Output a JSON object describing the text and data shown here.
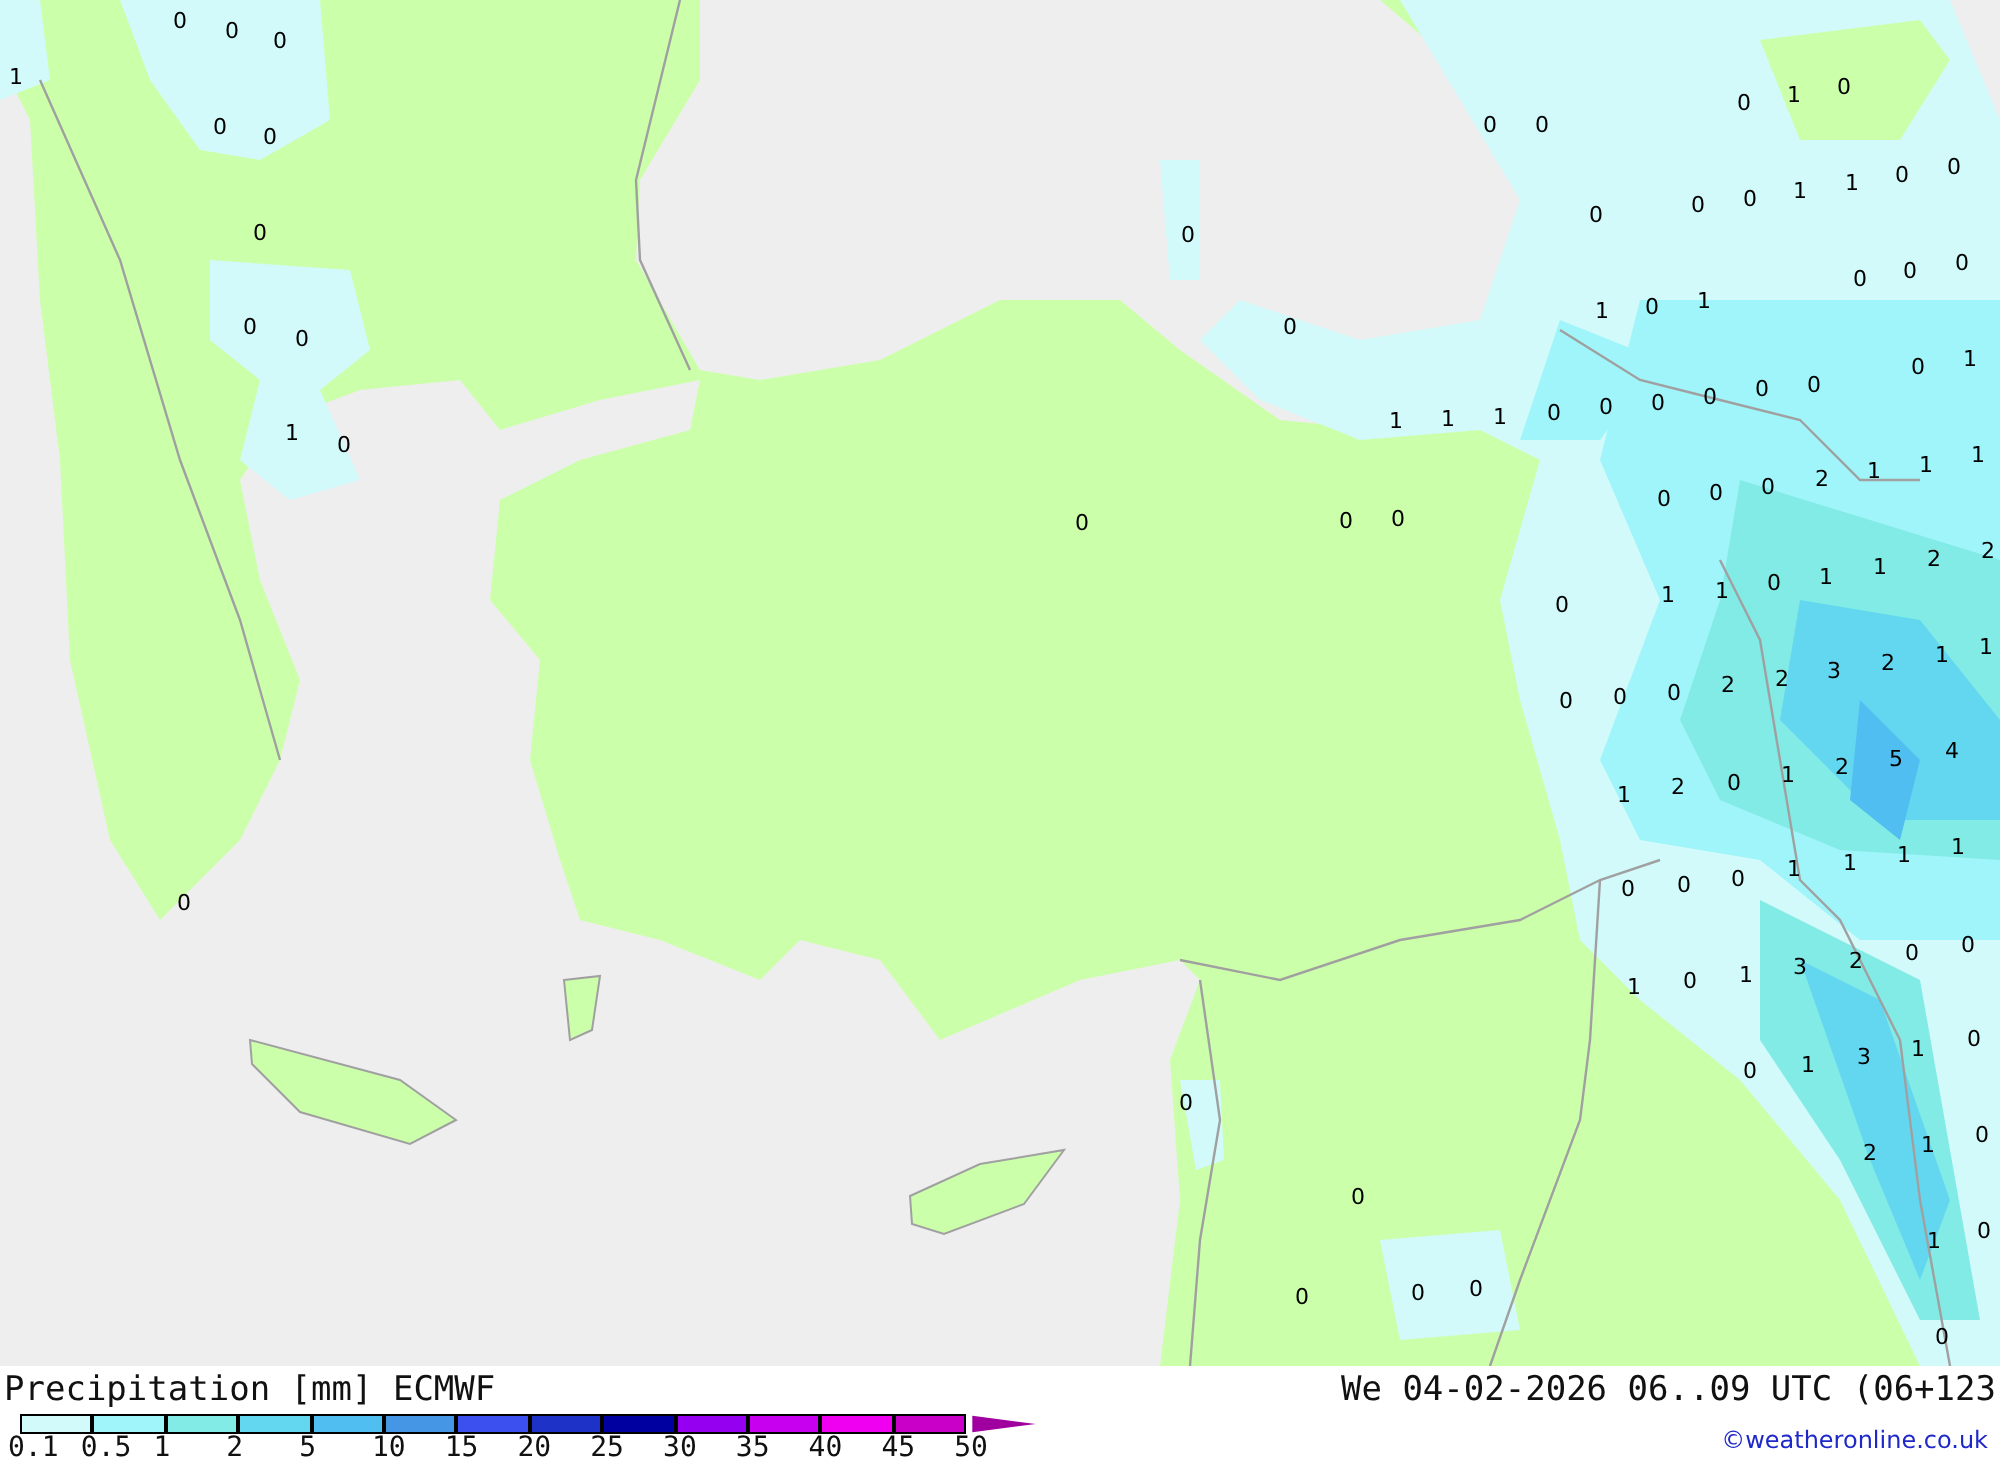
{
  "map": {
    "values": [
      "0",
      "0",
      "0",
      "1",
      "0",
      "0",
      "0",
      "0",
      "0",
      "1",
      "0",
      "0",
      "0",
      "0",
      "0",
      "0",
      "0",
      "0",
      "0",
      "0",
      "0",
      "0",
      "0",
      "0",
      "0",
      "1",
      "0",
      "0",
      "0",
      "0",
      "1",
      "1",
      "0",
      "0",
      "0",
      "0",
      "0",
      "1",
      "0",
      "1",
      "0",
      "1",
      "1",
      "1",
      "1",
      "0",
      "0",
      "0",
      "0",
      "0",
      "0",
      "2",
      "1",
      "1",
      "1",
      "0",
      "0",
      "0",
      "0",
      "1",
      "1",
      "0",
      "1",
      "1",
      "2",
      "2",
      "0",
      "0",
      "0",
      "2",
      "2",
      "3",
      "2",
      "1",
      "1",
      "1",
      "2",
      "0",
      "1",
      "2",
      "5",
      "4",
      "0",
      "0",
      "0",
      "1",
      "1",
      "1",
      "1",
      "1",
      "0",
      "1",
      "3",
      "2",
      "0",
      "0",
      "0",
      "1",
      "3",
      "1",
      "0",
      "2",
      "1",
      "0",
      "1",
      "0",
      "0"
    ]
  },
  "legend": {
    "title": "Precipitation [mm] ECMWF",
    "valid_time": "We 04-02-2026 06..09 UTC (06+123",
    "items": [
      {
        "kind": "swatch",
        "label": "0.1",
        "color": "#d2fafa"
      },
      {
        "kind": "swatch",
        "label": "0.5",
        "color": "#a0f5fa"
      },
      {
        "kind": "swatch",
        "label": "1",
        "color": "#82ebe6"
      },
      {
        "kind": "swatch",
        "label": "2",
        "color": "#64d7f0"
      },
      {
        "kind": "swatch",
        "label": "5",
        "color": "#50bef0"
      },
      {
        "kind": "swatch",
        "label": "10",
        "color": "#4696e6"
      },
      {
        "kind": "swatch",
        "label": "15",
        "color": "#3c50f0"
      },
      {
        "kind": "swatch",
        "label": "20",
        "color": "#1e32c8"
      },
      {
        "kind": "swatch",
        "label": "25",
        "color": "#0000a0"
      },
      {
        "kind": "swatch",
        "label": "30",
        "color": "#9600f0"
      },
      {
        "kind": "swatch",
        "label": "35",
        "color": "#c800f0"
      },
      {
        "kind": "swatch",
        "label": "40",
        "color": "#f000f0"
      },
      {
        "kind": "swatch",
        "label": "45",
        "color": "#c800c8"
      },
      {
        "kind": "arrow",
        "label": "50",
        "color": "#a000a0"
      }
    ],
    "credit": "©weatheronline.co.uk"
  }
}
